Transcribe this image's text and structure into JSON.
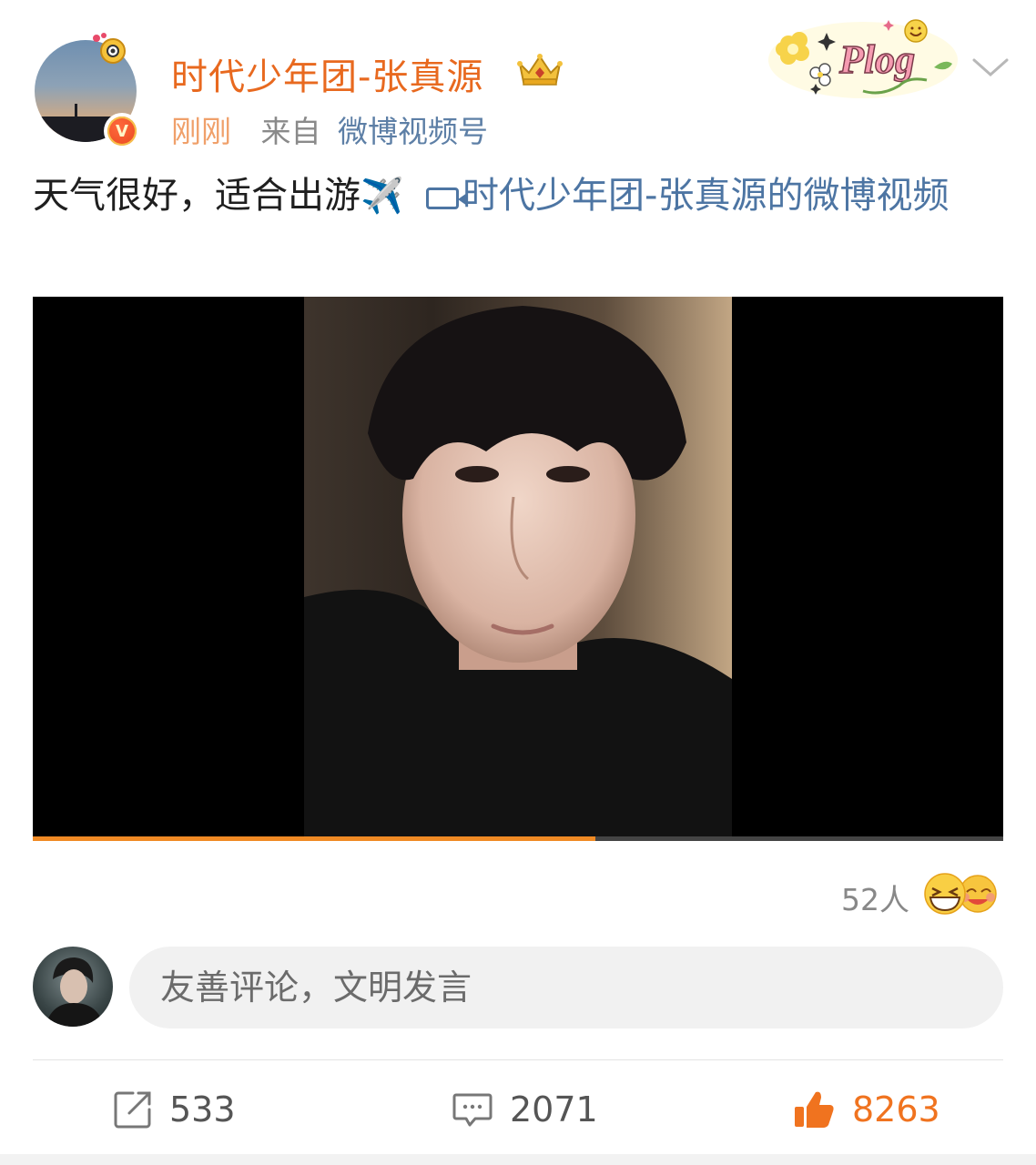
{
  "post": {
    "author": "时代少年团-张真源",
    "time": "刚刚",
    "from_label": "来自",
    "source": "微博视频号",
    "text": "天气很好，适合出游",
    "emoji": "✈️",
    "video_link_text": "时代少年团-张真源的微博视频"
  },
  "sticker": {
    "text": "Plog"
  },
  "video": {
    "progress": 0.58
  },
  "reactions": {
    "count_label": "52人"
  },
  "comment": {
    "placeholder": "友善评论，文明发言"
  },
  "actions": {
    "repost_count": "533",
    "comment_count": "2071",
    "like_count": "8263"
  },
  "colors": {
    "username": "#e8691f",
    "link": "#4d75a3",
    "like": "#f0731f",
    "progress": "#f08a24"
  },
  "icons": [
    "chevron-down-icon",
    "crown-icon",
    "verified-icon",
    "video-link-icon",
    "repost-icon",
    "comment-icon",
    "like-icon"
  ]
}
